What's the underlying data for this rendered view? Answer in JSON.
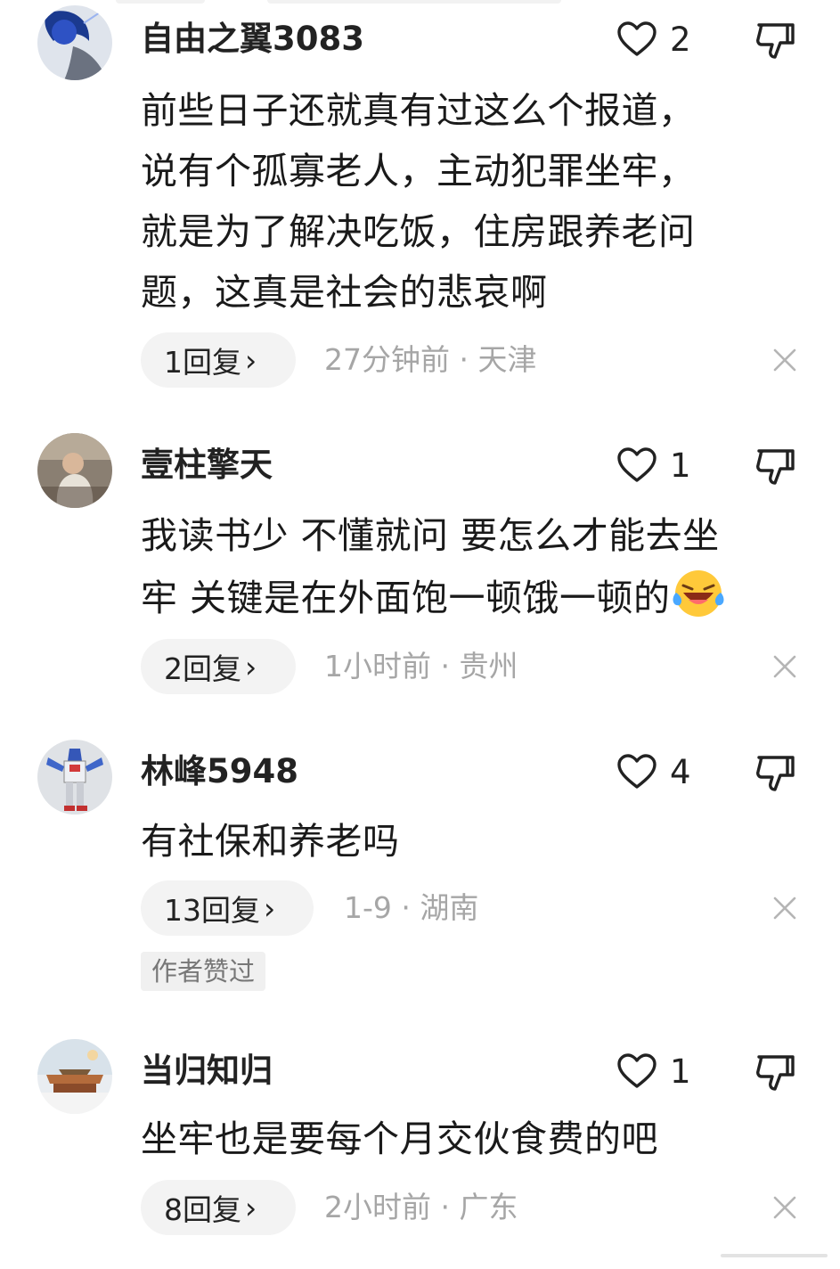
{
  "comments": [
    {
      "username": "自由之翼3083",
      "likes": "2",
      "text": "前些日子还就真有过这么个报道，说有个孤寡老人，主动犯罪坐牢，就是为了解决吃饭，住房跟养老问题，这真是社会的悲哀啊",
      "lines": [
        "前些日子还就真有过这么个报道，",
        "说有个孤寡老人，主动犯罪坐牢，",
        "就是为了解决吃饭，住房跟养老问",
        "题，这真是社会的悲哀啊"
      ],
      "replies": "1回复",
      "meta": "27分钟前 · 天津"
    },
    {
      "username": "壹柱擎天",
      "likes": "1",
      "lines": [
        "我读书少 不懂就问 要怎么才能去坐",
        "牢 关键是在外面饱一顿饿一顿的"
      ],
      "emoji": "laughing-crying-emoji",
      "replies": "2回复",
      "meta": "1小时前 · 贵州"
    },
    {
      "username": "林峰5948",
      "likes": "4",
      "lines": [
        "有社保和养老吗"
      ],
      "replies": "13回复",
      "meta": "1-9 · 湖南",
      "badge": "作者赞过"
    },
    {
      "username": "当归知归",
      "likes": "1",
      "lines": [
        "坐牢也是要每个月交伙食费的吧"
      ],
      "replies": "8回复",
      "meta": "2小时前 · 广东"
    }
  ],
  "icons": {
    "like": "heart-outline-icon",
    "dislike": "thumbs-down-outline-icon",
    "reply_arrow": "chevron-right-icon",
    "close": "close-icon"
  },
  "reply_arrow_glyph": "›",
  "colors": {
    "text": "#1a1a1a",
    "meta": "#a6a6a6",
    "pill": "#f3f3f3"
  }
}
